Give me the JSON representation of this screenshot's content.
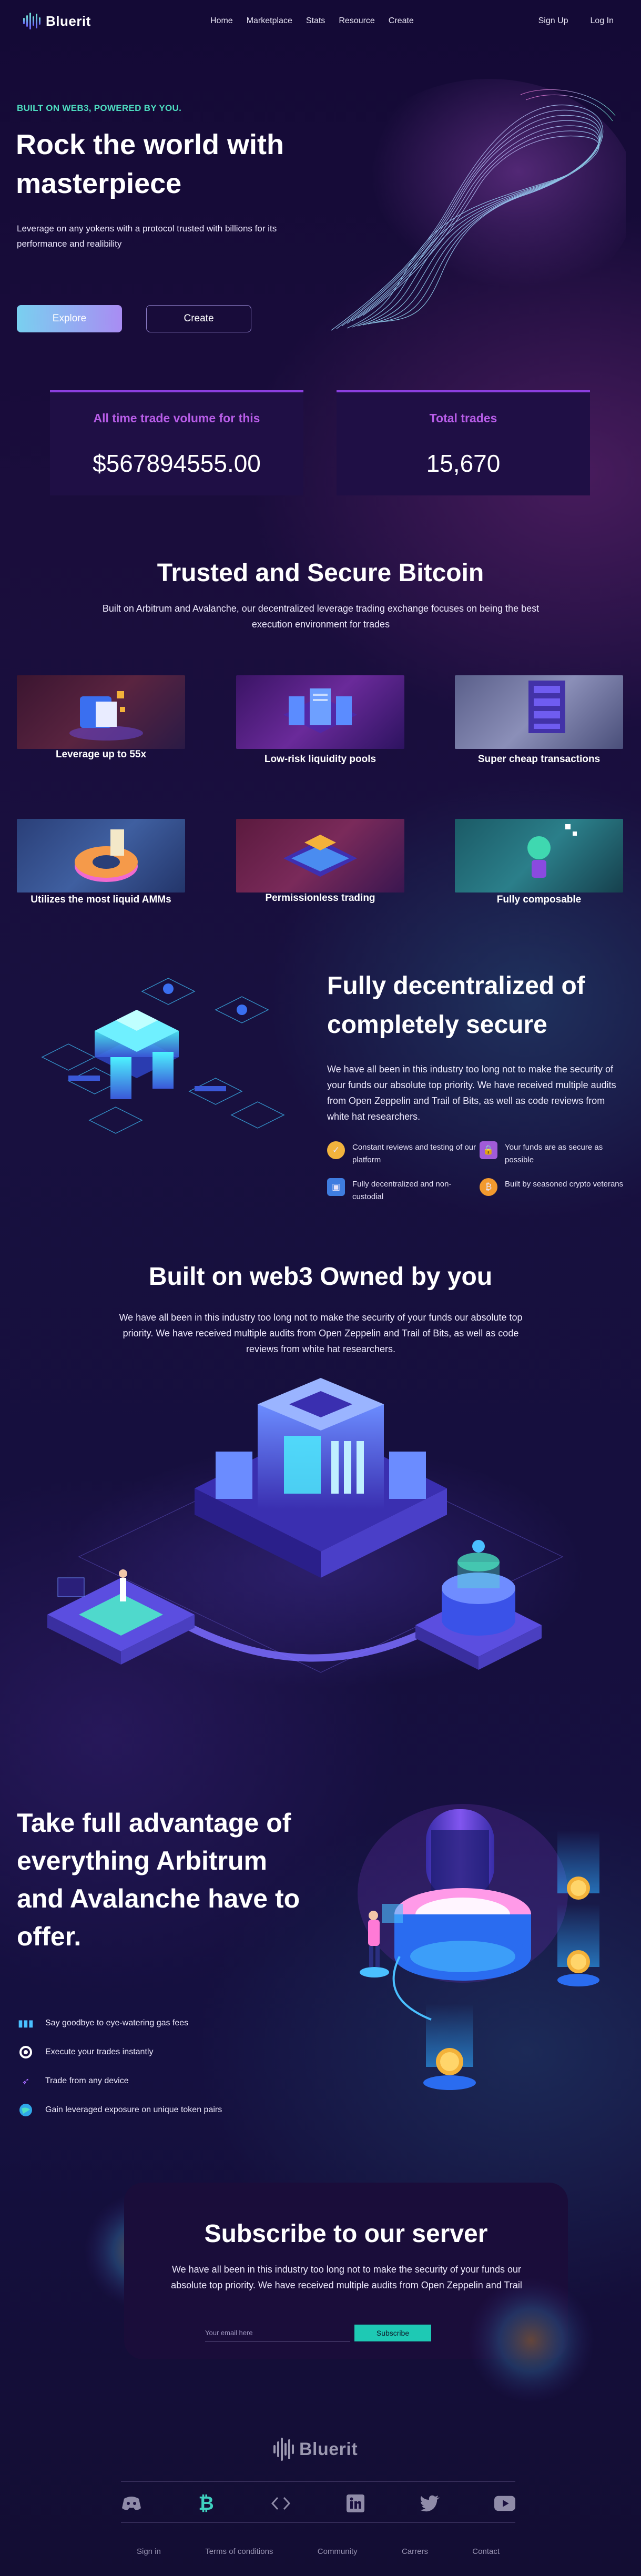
{
  "brand": {
    "name": "Bluerit"
  },
  "nav": {
    "links": [
      "Home",
      "Marketplace",
      "Stats",
      "Resource",
      "Create"
    ],
    "sign_up": "Sign Up",
    "log_in": "Log In"
  },
  "hero": {
    "kicker": "BUILT ON WEB3, POWERED BY YOU.",
    "title": "Rock the world with masterpiece",
    "subtitle": "Leverage on any yokens with a protocol trusted with billions for its performance and realibility",
    "explore_label": "Explore",
    "create_label": "Create"
  },
  "stats": [
    {
      "label": "All time trade volume for this",
      "value": "$567894555.00"
    },
    {
      "label": "Total trades",
      "value": "15,670"
    }
  ],
  "trusted": {
    "title": "Trusted and Secure Bitcoin",
    "text": "Built on Arbitrum and Avalanche, our decentralized leverage trading exchange focuses on being the best execution environment for trades",
    "cards": [
      {
        "label": "Leverage up to 55x",
        "icon": "vault-illustration"
      },
      {
        "label": "Low-risk liquidity pools",
        "icon": "server-illustration"
      },
      {
        "label": "Super cheap transactions",
        "icon": "stack-illustration"
      },
      {
        "label": "Utilizes the most liquid AMMs",
        "icon": "donut-chart-illustration"
      },
      {
        "label": "Permissionless trading",
        "icon": "platform-illustration"
      },
      {
        "label": "Fully composable",
        "icon": "robot-illustration"
      }
    ]
  },
  "decentralized": {
    "title": "Fully decentralized of completely secure",
    "text": "We have all been in this industry too long not to make the security of your funds our absolute top priority. We have received multiple audits from Open Zeppelin and Trail of Bits, as well as code reviews from white hat researchers.",
    "features": [
      {
        "text": "Constant reviews and testing of our platform",
        "icon": "review-icon",
        "color": "#f2b33d"
      },
      {
        "text": "Your funds are as secure as possible",
        "icon": "lock-icon",
        "color": "#a05bd8"
      },
      {
        "text": "Fully decentralized and non-custodial",
        "icon": "wallet-icon",
        "color": "#3f7de0"
      },
      {
        "text": "Built by seasoned crypto veterans",
        "icon": "bitcoin-icon",
        "color": "#f29a2e"
      }
    ]
  },
  "web3": {
    "title": "Built on web3 Owned by you",
    "text": "We have all been in this industry too long not to make the security of your funds our absolute top priority. We have received multiple audits from Open Zeppelin and Trail of Bits, as well as code reviews from white hat researchers."
  },
  "advantage": {
    "title": "Take full advantage of everything Arbitrum and Avalanche have to offer.",
    "items": [
      {
        "text": "Say goodbye to eye-watering gas fees",
        "icon": "chart-icon"
      },
      {
        "text": "Execute your trades instantly",
        "icon": "target-icon"
      },
      {
        "text": "Trade from any device",
        "icon": "rocket-icon"
      },
      {
        "text": "Gain leveraged exposure on unique token pairs",
        "icon": "globe-icon"
      }
    ]
  },
  "subscribe": {
    "title": "Subscribe to our server",
    "text": "We have all been in this industry too long not to make the security of your funds our absolute top priority. We have received multiple audits from Open Zeppelin and Trail",
    "placeholder": "Your email here",
    "button": "Subscribe"
  },
  "footer": {
    "social": [
      "discord-icon",
      "bitcoin-icon",
      "code-icon",
      "linkedin-icon",
      "twitter-icon",
      "youtube-icon"
    ],
    "links": [
      "Sign in",
      "Terms of conditions",
      "Community",
      "Carrers",
      "Contact"
    ]
  },
  "colors": {
    "accent_teal": "#4ee0c2",
    "accent_purple": "#b85de8",
    "background": "#160f3e"
  }
}
